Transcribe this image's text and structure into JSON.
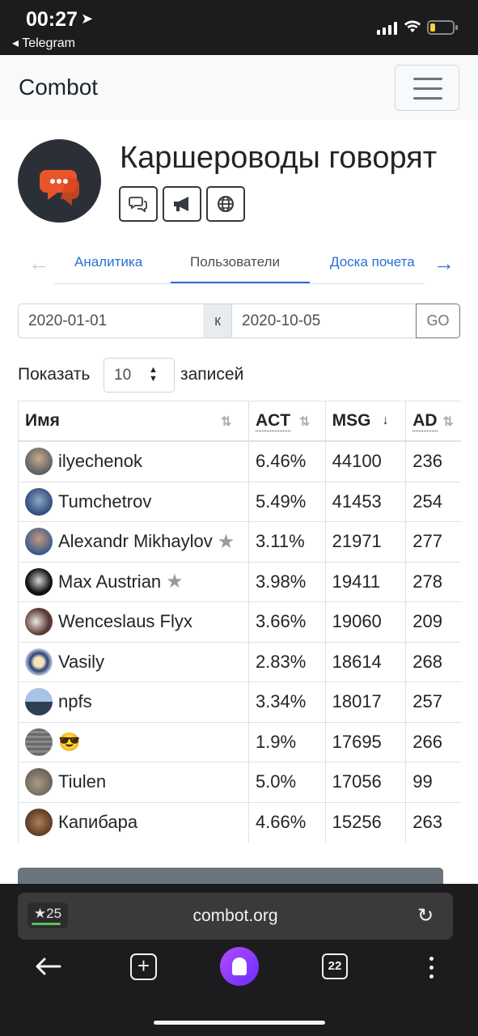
{
  "status": {
    "time": "00:27",
    "back_app": "Telegram"
  },
  "navbar": {
    "brand": "Combot"
  },
  "group": {
    "title": "Каршероводы говорят"
  },
  "tabs": [
    {
      "label": "Аналитика"
    },
    {
      "label": "Пользователи"
    },
    {
      "label": "Доска почета"
    }
  ],
  "filter": {
    "from": "2020-01-01",
    "separator": "к",
    "to": "2020-10-05",
    "go": "GO"
  },
  "entries": {
    "show": "Показать",
    "value": "10",
    "records": "записей"
  },
  "table": {
    "headers": [
      "Имя",
      "ACT",
      "MSG",
      "AD"
    ],
    "rows": [
      {
        "name": "ilyechenok",
        "act": "6.46%",
        "msg": "44100",
        "ad": "236"
      },
      {
        "name": "Tumchetrov",
        "act": "5.49%",
        "msg": "41453",
        "ad": "254"
      },
      {
        "name": "Alexandr Mikhaylov",
        "act": "3.11%",
        "msg": "21971",
        "ad": "277"
      },
      {
        "name": "Max Austrian",
        "act": "3.98%",
        "msg": "19411",
        "ad": "278"
      },
      {
        "name": "Wenceslaus Flyx",
        "act": "3.66%",
        "msg": "19060",
        "ad": "209"
      },
      {
        "name": "Vasily",
        "act": "2.83%",
        "msg": "18614",
        "ad": "268"
      },
      {
        "name": "npfs",
        "act": "3.34%",
        "msg": "18017",
        "ad": "257"
      },
      {
        "name": "😎",
        "act": "1.9%",
        "msg": "17695",
        "ad": "266"
      },
      {
        "name": "Tiulen",
        "act": "5.0%",
        "msg": "17056",
        "ad": "99"
      },
      {
        "name": "Капибара",
        "act": "4.66%",
        "msg": "15256",
        "ad": "263"
      }
    ]
  },
  "browser": {
    "rating": "25",
    "url": "combot.org",
    "tabs_count": "22"
  },
  "colors": {
    "link": "#2a6fd6",
    "brand_icon_orange": "#e8552b",
    "dark_bar": "#1c1c1e"
  }
}
